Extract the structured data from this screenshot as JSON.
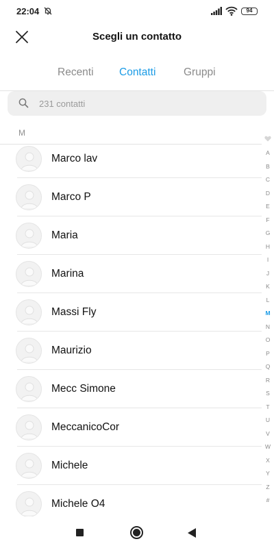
{
  "status": {
    "time": "22:04",
    "battery": "94",
    "icons": [
      "dnd-bell-off-icon",
      "signal-icon",
      "wifi-icon",
      "battery-icon"
    ]
  },
  "header": {
    "title": "Scegli un contatto",
    "close_icon": "close-icon"
  },
  "tabs": [
    {
      "label": "Recenti",
      "active": false
    },
    {
      "label": "Contatti",
      "active": true
    },
    {
      "label": "Gruppi",
      "active": false
    }
  ],
  "search": {
    "placeholder": "231 contatti",
    "icon": "search-icon"
  },
  "section": {
    "letter": "M"
  },
  "contacts": [
    {
      "name": "Marco lav"
    },
    {
      "name": "Marco P"
    },
    {
      "name": "Maria"
    },
    {
      "name": "Marina"
    },
    {
      "name": "Massi Fly"
    },
    {
      "name": "Maurizio"
    },
    {
      "name": "Mecc Simone"
    },
    {
      "name": "MeccanicoCor"
    },
    {
      "name": "Michele"
    },
    {
      "name": "Michele O4"
    }
  ],
  "alphabet_index": {
    "letters": [
      "A",
      "B",
      "C",
      "D",
      "E",
      "F",
      "G",
      "H",
      "I",
      "J",
      "K",
      "L",
      "M",
      "N",
      "O",
      "P",
      "Q",
      "R",
      "S",
      "T",
      "U",
      "V",
      "W",
      "X",
      "Y",
      "Z",
      "#"
    ],
    "active": "M",
    "favorites_icon": "heart-icon"
  },
  "navbar": {
    "icons": [
      "recents-square-icon",
      "home-circle-icon",
      "back-triangle-icon"
    ]
  },
  "colors": {
    "accent": "#1a9be6",
    "text": "#111111",
    "muted": "#8a8a8a",
    "search_bg": "#efefef"
  }
}
